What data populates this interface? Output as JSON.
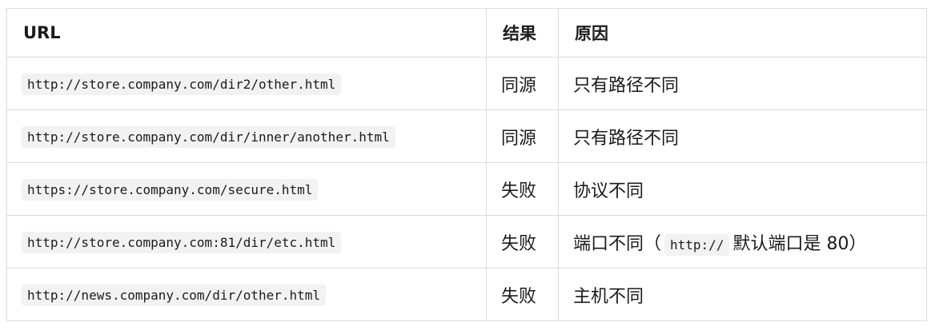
{
  "table": {
    "headers": {
      "url": "URL",
      "result": "结果",
      "reason": "原因"
    },
    "rows": [
      {
        "url": "http://store.company.com/dir2/other.html",
        "result": "同源",
        "reason": "只有路径不同"
      },
      {
        "url": "http://store.company.com/dir/inner/another.html",
        "result": "同源",
        "reason": "只有路径不同"
      },
      {
        "url": "https://store.company.com/secure.html",
        "result": "失败",
        "reason": "协议不同"
      },
      {
        "url": "http://store.company.com:81/dir/etc.html",
        "result": "失败",
        "reason_prefix": "端口不同（",
        "reason_code": "http://",
        "reason_suffix": "默认端口是 80）"
      },
      {
        "url": "http://news.company.com/dir/other.html",
        "result": "失败",
        "reason": "主机不同"
      }
    ]
  }
}
